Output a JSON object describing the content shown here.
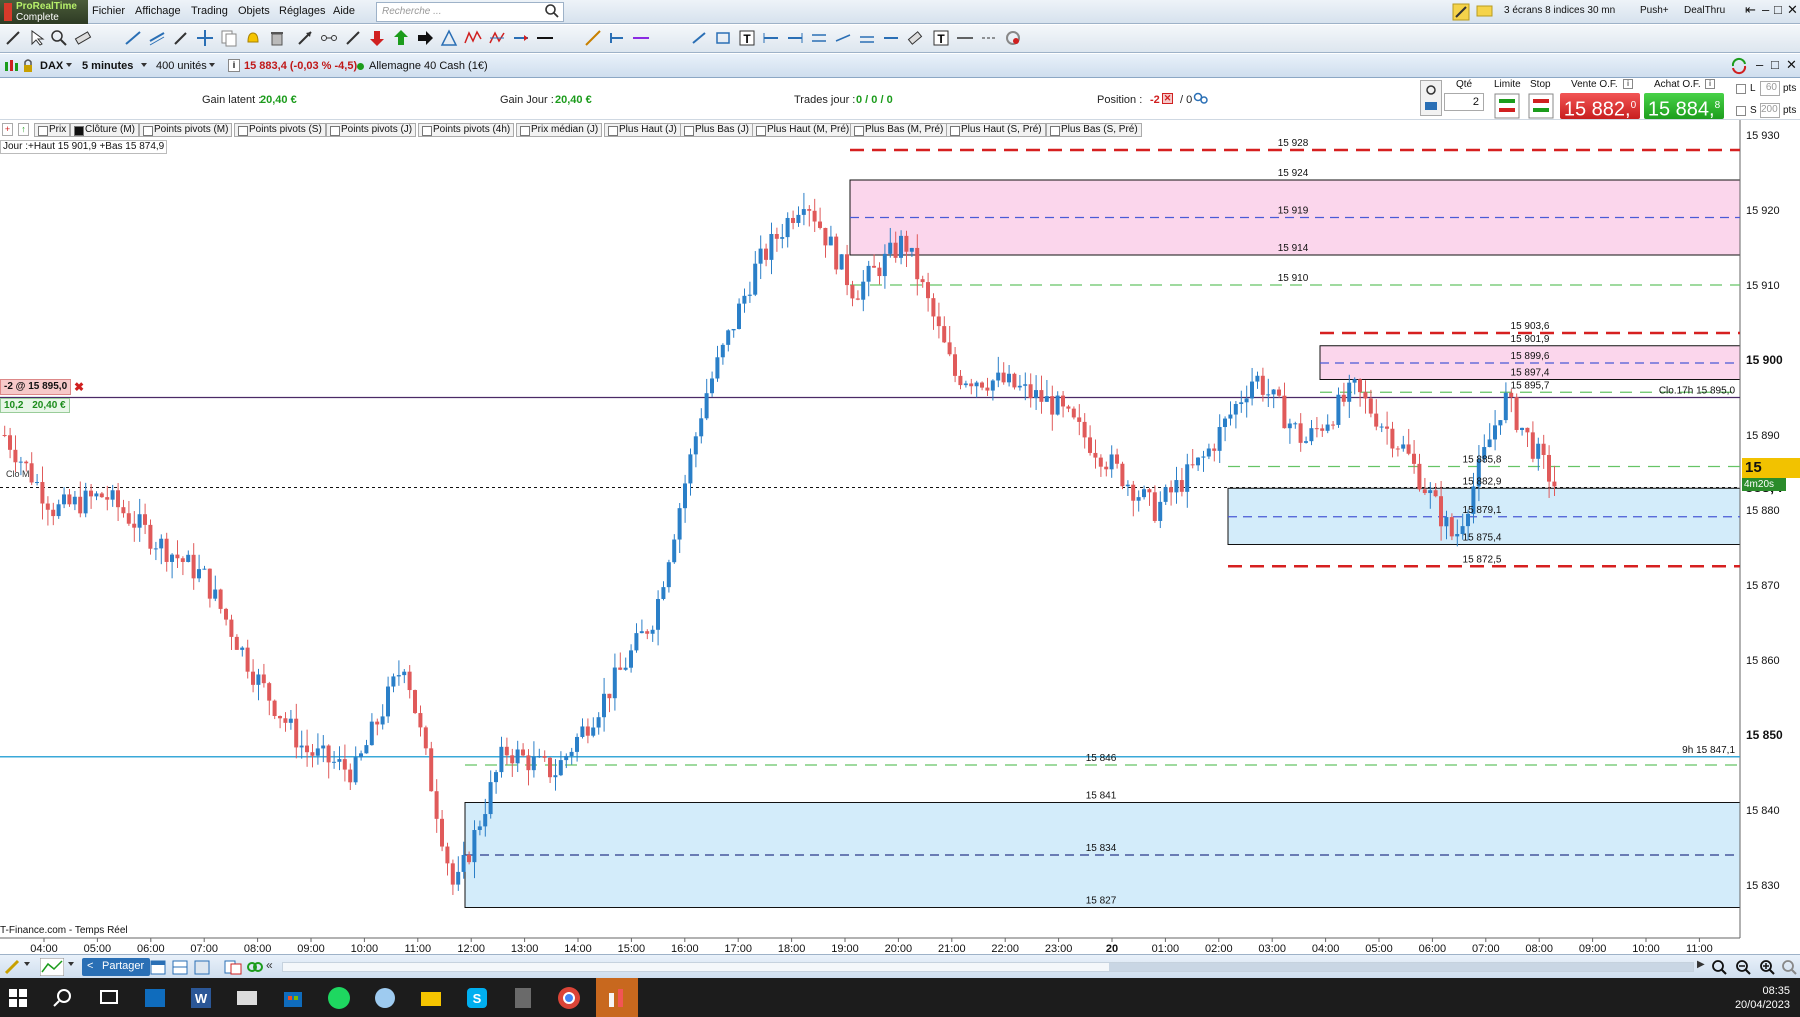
{
  "app": {
    "brand_line1": "ProRealTime",
    "brand_line2": "Complete"
  },
  "menu": [
    "Fichier",
    "Affichage",
    "Trading",
    "Objets",
    "Réglages",
    "Aide"
  ],
  "search": {
    "placeholder": "Recherche ..."
  },
  "topright": {
    "screens": "3 écrans 8 indices 30 mn",
    "push": "Push+",
    "dealthru": "DealThru"
  },
  "instrument": {
    "symbol": "DAX",
    "timeframe": "5 minutes",
    "units": "400 unités",
    "quote": "15 883,4 (-0,03 % -4,5)",
    "name": "Allemagne 40 Cash (1€)"
  },
  "order_panel": {
    "gain_latent_label": "Gain latent :",
    "gain_latent_value": "20,40 €",
    "gain_jour_label": "Gain Jour :",
    "gain_jour_value": "20,40 €",
    "trades_label": "Trades jour :",
    "trades_value": "0 / 0 / 0",
    "position_label": "Position :",
    "position_value": "-2",
    "position_extra": "/ 0",
    "qty_label": "Qté",
    "qty_value": "2",
    "limit_label": "Limite",
    "stop_label": "Stop",
    "sell_label": "Vente O.F.",
    "sell_price": "15 882,",
    "sell_frac": "0",
    "buy_label": "Achat O.F.",
    "buy_price": "15 884,",
    "buy_frac": "8",
    "l_label": "L",
    "l_value": "60",
    "s_label": "S",
    "s_value": "200",
    "pts": "pts"
  },
  "indicators": [
    {
      "label": "Prix",
      "on": false
    },
    {
      "label": "Clôture (M)",
      "on": true
    },
    {
      "label": "Points pivots (M)",
      "on": false
    },
    {
      "label": "Points pivots (S)",
      "on": false
    },
    {
      "label": "Points pivots (J)",
      "on": false
    },
    {
      "label": "Points pivots (4h)",
      "on": false
    },
    {
      "label": "Prix médian (J)",
      "on": false
    },
    {
      "label": "Plus Haut (J)",
      "on": false
    },
    {
      "label": "Plus Bas (J)",
      "on": false
    },
    {
      "label": "Plus Haut (M, Pré)",
      "on": false
    },
    {
      "label": "Plus Bas (M, Pré)",
      "on": false
    },
    {
      "label": "Plus Haut (S, Pré)",
      "on": false
    },
    {
      "label": "Plus Bas (S, Pré)",
      "on": false
    }
  ],
  "day_note": "Jour :+Haut 15 901,9 +Bas 15 874,9",
  "position_tag": "-2 @ 15 895,0",
  "pnl_tag": {
    "pts": "10,2",
    "eur": "20,40 €"
  },
  "clo_m_label": "Clo M",
  "price_tag": "15 883,4",
  "timer_tag": "4m20s",
  "footer_note": "T-Finance.com - Temps Réel",
  "share_label": "Partager",
  "clock": {
    "time": "08:35",
    "date": "20/04/2023"
  },
  "chart_data": {
    "type": "candlestick",
    "instrument": "DAX",
    "timeframe": "5 minutes",
    "y_ticks": [
      "15 930",
      "15 920",
      "15 910",
      "15 900",
      "15 890",
      "15 880",
      "15 870",
      "15 860",
      "15 850",
      "15 840",
      "15 830"
    ],
    "ylim": [
      15823,
      15931
    ],
    "x_ticks": [
      "04:00",
      "05:00",
      "06:00",
      "07:00",
      "08:00",
      "09:00",
      "10:00",
      "11:00",
      "12:00",
      "13:00",
      "14:00",
      "15:00",
      "16:00",
      "17:00",
      "18:00",
      "19:00",
      "20:00",
      "21:00",
      "22:00",
      "23:00",
      "20",
      "01:00",
      "02:00",
      "03:00",
      "04:00",
      "05:00",
      "06:00",
      "07:00",
      "08:00",
      "09:00",
      "10:00",
      "11:00"
    ],
    "level_labels_upper": [
      "15 928",
      "15 924",
      "15 919",
      "15 914",
      "15 910"
    ],
    "level_labels_right": [
      "15 903,6",
      "15 901,9",
      "15 899,6",
      "15 897,4",
      "15 895,7",
      "15 885,8",
      "15 882,9",
      "15 879,1",
      "15 875,4",
      "15 872,5"
    ],
    "level_labels_lower": [
      "15 846",
      "15 841",
      "15 834",
      "15 827"
    ],
    "right_notes": [
      "Clo.17h 15 895,0",
      "9h 15 847,1"
    ],
    "position_price": 15895.0,
    "last_price": 15883.4,
    "close_m": 15883.0,
    "approx_path": [
      {
        "t": "03:30",
        "p": 15890
      },
      {
        "t": "04:00",
        "p": 15880
      },
      {
        "t": "05:00",
        "p": 15882
      },
      {
        "t": "06:00",
        "p": 15876
      },
      {
        "t": "07:00",
        "p": 15871
      },
      {
        "t": "08:00",
        "p": 15858
      },
      {
        "t": "09:00",
        "p": 15848
      },
      {
        "t": "10:00",
        "p": 15845
      },
      {
        "t": "11:00",
        "p": 15860
      },
      {
        "t": "12:00",
        "p": 15829
      },
      {
        "t": "13:00",
        "p": 15848
      },
      {
        "t": "14:00",
        "p": 15845
      },
      {
        "t": "15:00",
        "p": 15855
      },
      {
        "t": "16:00",
        "p": 15866
      },
      {
        "t": "17:00",
        "p": 15895
      },
      {
        "t": "18:00",
        "p": 15912
      },
      {
        "t": "19:00",
        "p": 15922
      },
      {
        "t": "20:00",
        "p": 15909
      },
      {
        "t": "21:00",
        "p": 15916
      },
      {
        "t": "22:00",
        "p": 15898
      },
      {
        "t": "23:00",
        "p": 15897
      },
      {
        "t": "00:00",
        "p": 15894
      },
      {
        "t": "01:00",
        "p": 15887
      },
      {
        "t": "02:00",
        "p": 15880
      },
      {
        "t": "03:00",
        "p": 15887
      },
      {
        "t": "04:00",
        "p": 15898
      },
      {
        "t": "05:00",
        "p": 15889
      },
      {
        "t": "06:00",
        "p": 15896
      },
      {
        "t": "07:00",
        "p": 15888
      },
      {
        "t": "07:45",
        "p": 15876
      },
      {
        "t": "08:15",
        "p": 15895
      },
      {
        "t": "08:35",
        "p": 15883.4
      }
    ]
  }
}
